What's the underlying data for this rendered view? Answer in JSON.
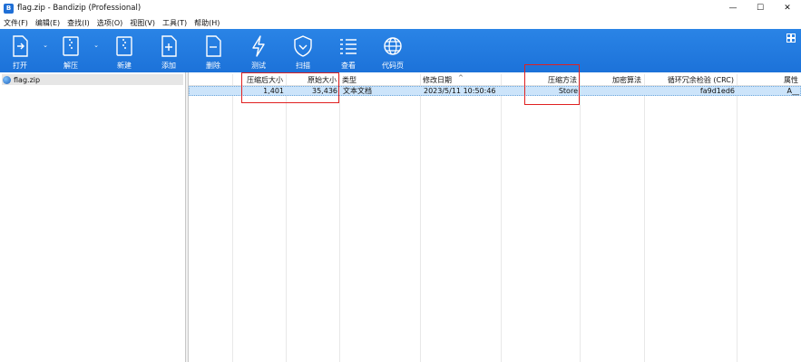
{
  "window": {
    "title": "flag.zip - Bandizip (Professional)",
    "app_icon_glyph": "B",
    "controls": [
      "—",
      "☐",
      "✕"
    ]
  },
  "menu": [
    "文件(F)",
    "编辑(E)",
    "查找(I)",
    "选项(O)",
    "视图(V)",
    "工具(T)",
    "帮助(H)"
  ],
  "toolbar": {
    "open": "打开",
    "extract": "解压",
    "new": "新建",
    "add": "添加",
    "delete": "删除",
    "test": "测试",
    "scan": "扫描",
    "view": "查看",
    "codepage": "代码页"
  },
  "tree": {
    "item": "flag.zip"
  },
  "columns": {
    "compressed_size": "压缩后大小",
    "original_size": "原始大小",
    "type": "类型",
    "modified": "修改日期",
    "method": "压缩方法",
    "encryption": "加密算法",
    "crc": "循环冗余检验 (CRC)",
    "attributes": "属性"
  },
  "files": [
    {
      "compressed_size": "1,401",
      "original_size": "35,436",
      "type": "文本文档",
      "modified": "2023/5/11 10:50:46",
      "method": "Store",
      "encryption": "",
      "crc": "fa9d1ed6",
      "attributes": "A__"
    }
  ],
  "colors": {
    "toolbar": "#1c72d9",
    "selection": "#cce4fa",
    "highlight_box": "#e02020"
  }
}
